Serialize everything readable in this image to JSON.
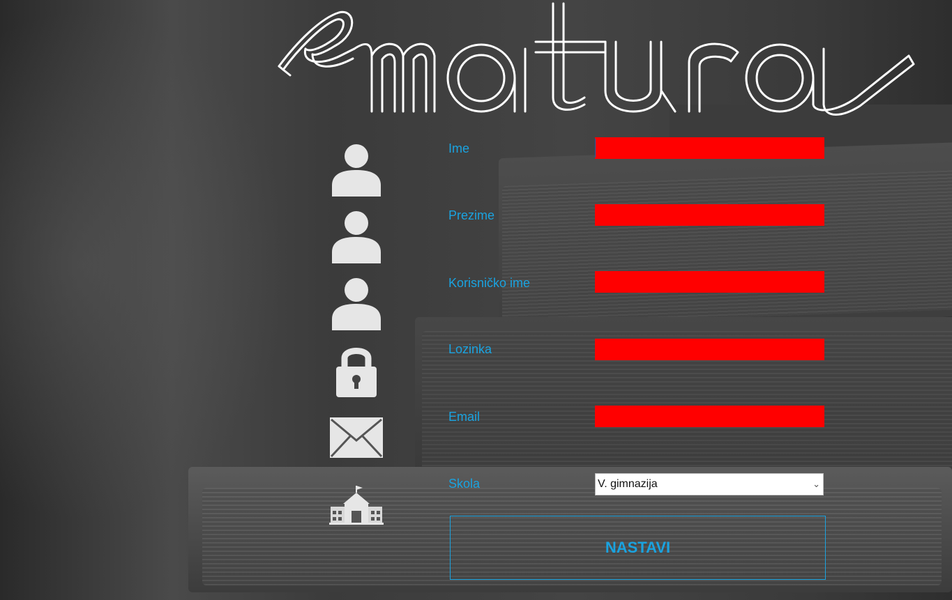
{
  "logo": {
    "text": "e-matura"
  },
  "form": {
    "fields": [
      {
        "label": "Ime",
        "value": ""
      },
      {
        "label": "Prezime",
        "value": ""
      },
      {
        "label": "Korisničko ime",
        "value": ""
      },
      {
        "label": "Lozinka",
        "value": ""
      },
      {
        "label": "Email",
        "value": ""
      }
    ],
    "school": {
      "label": "Skola",
      "selected": "V. gimnazija"
    },
    "submit_label": "NASTAVI"
  },
  "icons": [
    "user-icon",
    "user-icon",
    "user-icon",
    "lock-icon",
    "envelope-icon",
    "school-icon"
  ],
  "colors": {
    "accent": "#1aa3e0",
    "field_fill": "#ff0000",
    "logo_stroke": "#ffffff"
  }
}
